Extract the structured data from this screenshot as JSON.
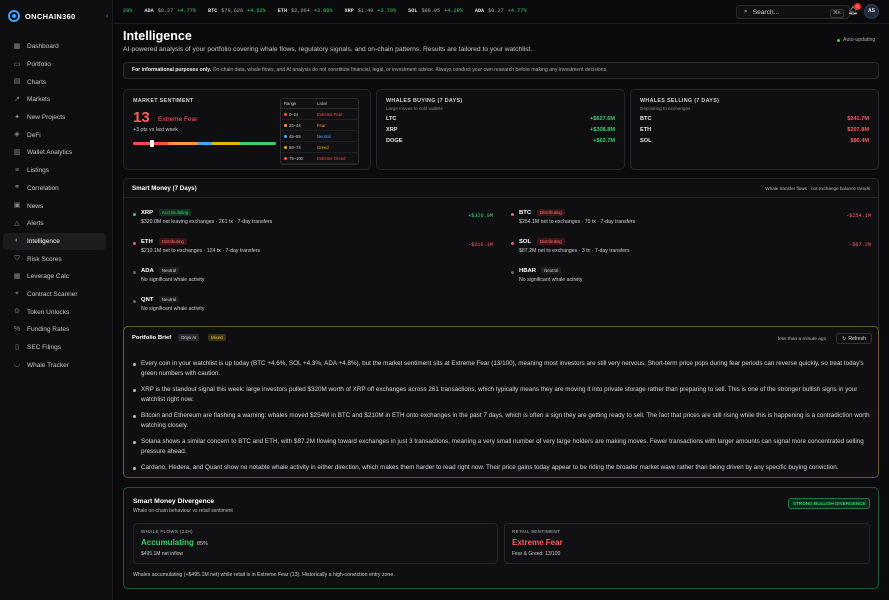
{
  "app": {
    "name": "ONCHAIN360"
  },
  "sidebar": {
    "items": [
      {
        "label": "Dashboard",
        "icon": "grid-icon"
      },
      {
        "label": "Portfolio",
        "icon": "wallet-icon"
      },
      {
        "label": "Charts",
        "icon": "chart-icon"
      },
      {
        "label": "Markets",
        "icon": "trend-icon"
      },
      {
        "label": "New Projects",
        "icon": "star-icon"
      },
      {
        "label": "DeFi",
        "icon": "layers-icon"
      },
      {
        "label": "Wallet Analytics",
        "icon": "analytics-icon"
      },
      {
        "label": "Listings",
        "icon": "list-icon"
      },
      {
        "label": "Correlation",
        "icon": "link-icon"
      },
      {
        "label": "News",
        "icon": "news-icon"
      },
      {
        "label": "Alerts",
        "icon": "bell-icon"
      },
      {
        "label": "Intelligence",
        "icon": "brain-icon"
      },
      {
        "label": "Risk Scores",
        "icon": "shield-icon"
      },
      {
        "label": "Leverage Calc",
        "icon": "calc-icon"
      },
      {
        "label": "Contract Scanner",
        "icon": "scan-icon"
      },
      {
        "label": "Token Unlocks",
        "icon": "unlock-icon"
      },
      {
        "label": "Funding Rates",
        "icon": "percent-icon"
      },
      {
        "label": "SEC Filings",
        "icon": "file-icon"
      },
      {
        "label": "Whale Tracker",
        "icon": "whale-icon"
      }
    ],
    "active": "Intelligence"
  },
  "ticker": {
    "lead": "28%",
    "items": [
      {
        "sym": "ADA",
        "price": "$0.27",
        "change": "+4.77%"
      },
      {
        "sym": "BTC",
        "price": "$79,626",
        "change": "+4.62%"
      },
      {
        "sym": "ETH",
        "price": "$2,064",
        "change": "+3.88%"
      },
      {
        "sym": "XRP",
        "price": "$1.40",
        "change": "+3.79%"
      },
      {
        "sym": "SOL",
        "price": "$86.05",
        "change": "+4.28%"
      },
      {
        "sym": "ADA",
        "price": "$0.27",
        "change": "+4.77%"
      }
    ]
  },
  "search": {
    "placeholder": "Search...",
    "shortcut": "⌘K"
  },
  "notifications": {
    "count": "1"
  },
  "user": {
    "initials": "AS"
  },
  "page": {
    "title": "Intelligence",
    "subtitle": "AI-powered analysis of your portfolio covering whale flows, regulatory signals, and on-chain patterns. Results are tailored to your watchlist.",
    "auto_update": "Auto-updating",
    "disclaimer_bold": "For informational purposes only.",
    "disclaimer_rest": " On-chain data, whale flows, and AI analysis do not constitute financial, legal, or investment advice. Always conduct your own research before making any investment decisions."
  },
  "sentiment": {
    "label": "MARKET SENTIMENT",
    "value": "13",
    "value_num": 13,
    "level": "Extreme Fear",
    "delta": "+3 pts vs last week",
    "table_head": [
      "Range",
      "Label"
    ],
    "table": [
      {
        "range": "0–24",
        "label": "Extreme Fear",
        "color": "#ff4d4d"
      },
      {
        "range": "25–44",
        "label": "Fear",
        "color": "#ff9a3c"
      },
      {
        "range": "45–55",
        "label": "Neutral",
        "color": "#4aa3ff"
      },
      {
        "range": "56–74",
        "label": "Greed",
        "color": "#e7b400"
      },
      {
        "range": "75–100",
        "label": "Extreme Greed",
        "color": "#ff4d4d"
      }
    ]
  },
  "whales_buying": {
    "label": "WHALES BUYING (7 DAYS)",
    "sub": "Large moves to cold wallets",
    "rows": [
      {
        "sym": "LTC",
        "val": "+$627.6M"
      },
      {
        "sym": "XRP",
        "val": "+$308.8M"
      },
      {
        "sym": "DOGE",
        "val": "+$62.7M"
      }
    ]
  },
  "whales_selling": {
    "label": "WHALES SELLING (7 DAYS)",
    "sub": "Depositing to exchanges",
    "rows": [
      {
        "sym": "BTC",
        "val": "$241.7M"
      },
      {
        "sym": "ETH",
        "val": "$207.8M"
      },
      {
        "sym": "SOL",
        "val": "$86.4M"
      }
    ]
  },
  "smart_money": {
    "title": "Smart Money (7 Days)",
    "note": "Whale transfer flows · not exchange balance trends",
    "items": [
      {
        "sym": "XRP",
        "tag": "Accumulating",
        "kind": "acc",
        "desc": "$320.0M net leaving exchanges · 261 tx · 7-day transfers",
        "val": "+$320.0M"
      },
      {
        "sym": "BTC",
        "tag": "Distributing",
        "kind": "dis",
        "desc": "$254.1M net to exchanges · 70 tx · 7-day transfers",
        "val": "-$254.1M"
      },
      {
        "sym": "ETH",
        "tag": "Distributing",
        "kind": "dis",
        "desc": "$210.1M net to exchanges · 124 tx · 7-day transfers",
        "val": "-$210.1M"
      },
      {
        "sym": "SOL",
        "tag": "Distributing",
        "kind": "dis",
        "desc": "$87.2M net to exchanges · 3 tx · 7-day transfers",
        "val": "-$87.2M"
      },
      {
        "sym": "ADA",
        "tag": "Neutral",
        "kind": "neu",
        "desc": "No significant whale activity",
        "val": ""
      },
      {
        "sym": "HBAR",
        "tag": "Neutral",
        "kind": "neu",
        "desc": "No significant whale activity",
        "val": ""
      },
      {
        "sym": "QNT",
        "tag": "Neutral",
        "kind": "neu",
        "desc": "No significant whale activity",
        "val": ""
      }
    ]
  },
  "brief": {
    "title": "Portfolio Brief",
    "pill_a": "Onyx AI",
    "pill_b": "Mixed",
    "time": "less than a minute ago",
    "refresh": "Refresh",
    "points": [
      "Every coin in your watchlist is up today (BTC +4.6%, SOL +4.3%, ADA +4.8%), but the market sentiment sits at Extreme Fear (13/100), meaning most investors are still very nervous. Short-term price pops during fear periods can reverse quickly, so treat today's green numbers with caution.",
      "XRP is the standout signal this week: large investors pulled $320M worth of XRP off exchanges across 261 transactions, which typically means they are moving it into private storage rather than preparing to sell. This is one of the stronger bullish signs in your watchlist right now.",
      "Bitcoin and Ethereum are flashing a warning: whales moved $254M in BTC and $210M in ETH onto exchanges in the past 7 days, which is often a sign they are getting ready to sell. The fact that prices are still rising while this is happening is a contradiction worth watching closely.",
      "Solana shows a similar concern to BTC and ETH, with $87.2M flowing toward exchanges in just 3 transactions, meaning a very small number of very large holders are making moves. Fewer transactions with larger amounts can signal more concentrated selling pressure ahead.",
      "Cardano, Hedera, and Quant show no notable whale activity in either direction, which makes them harder to read right now. Their price gains today appear to be riding the broader market wave rather than being driven by any specific buying conviction."
    ]
  },
  "divergence": {
    "title": "Smart Money Divergence",
    "sub": "Whale on-chain behaviour vs retail sentiment",
    "badge": "STRONG BULLISH DIVERGENCE",
    "flows_label": "WHALE FLOWS (24H)",
    "flows_value": "Accumulating",
    "flows_pct": "85%",
    "flows_sub": "$495.1M net inflow",
    "retail_label": "RETAIL SENTIMENT",
    "retail_value": "Extreme Fear",
    "retail_sub": "Fear & Greed: 13/100",
    "footer": "Whales accumulating (+$495.1M net) while retail is in Extreme Fear (13). Historically a high-conviction entry zone."
  }
}
